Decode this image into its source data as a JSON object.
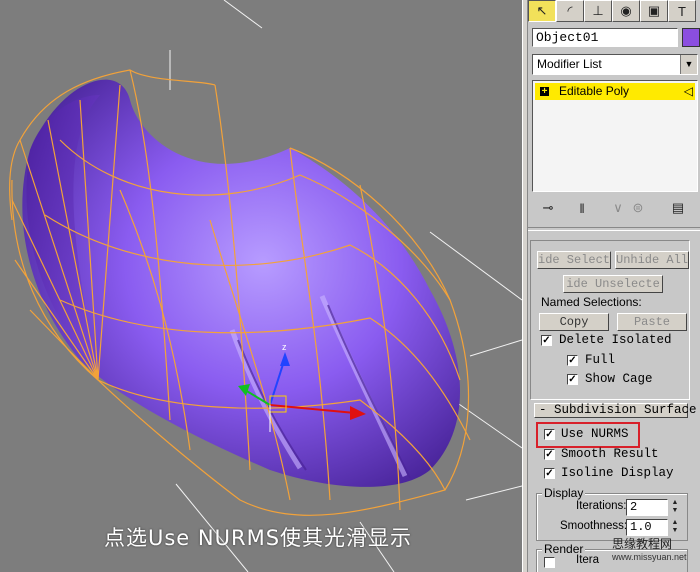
{
  "viewport": {
    "caption": "点选Use NURMS使其光滑显示"
  },
  "toolbar": {
    "tabs": [
      "create-icon",
      "modify-icon",
      "hierarchy-icon",
      "motion-icon",
      "display-icon",
      "utilities-icon"
    ],
    "active_tab": "modify-icon"
  },
  "object": {
    "name": "Object01",
    "color": "#8b4ee0"
  },
  "modifier_list": {
    "value": "Modifier List"
  },
  "stack": {
    "items": [
      {
        "label": "Editable Poly",
        "highlight": "#ffea00"
      }
    ]
  },
  "selection": {
    "hide_selected": "ide Selecte",
    "unhide_all": "Unhide All",
    "hide_unselected": "ide Unselecte",
    "named_selections_label": "Named Selections:",
    "copy": "Copy",
    "paste": "Paste",
    "delete_isolated": "Delete Isolated",
    "full": "Full",
    "show_cage": "Show Cage"
  },
  "subdivision": {
    "title": "Subdivision Surface",
    "use_nurms": "Use NURMS",
    "smooth_result": "Smooth Result",
    "isoline_display": "Isoline Display",
    "display_group": "Display",
    "iterations_label": "Iterations:",
    "iterations_value": "2",
    "smoothness_label": "Smoothness:",
    "smoothness_value": "1.0",
    "render_group": "Render",
    "render_iterations_label": "Itera"
  },
  "watermark": {
    "line1": "思缘教程网",
    "line2": "www.missyuan.net"
  },
  "checked": {
    "delete_isolated": true,
    "full": true,
    "show_cage": true,
    "use_nurms": true,
    "smooth_result": true,
    "isoline_display": true
  }
}
